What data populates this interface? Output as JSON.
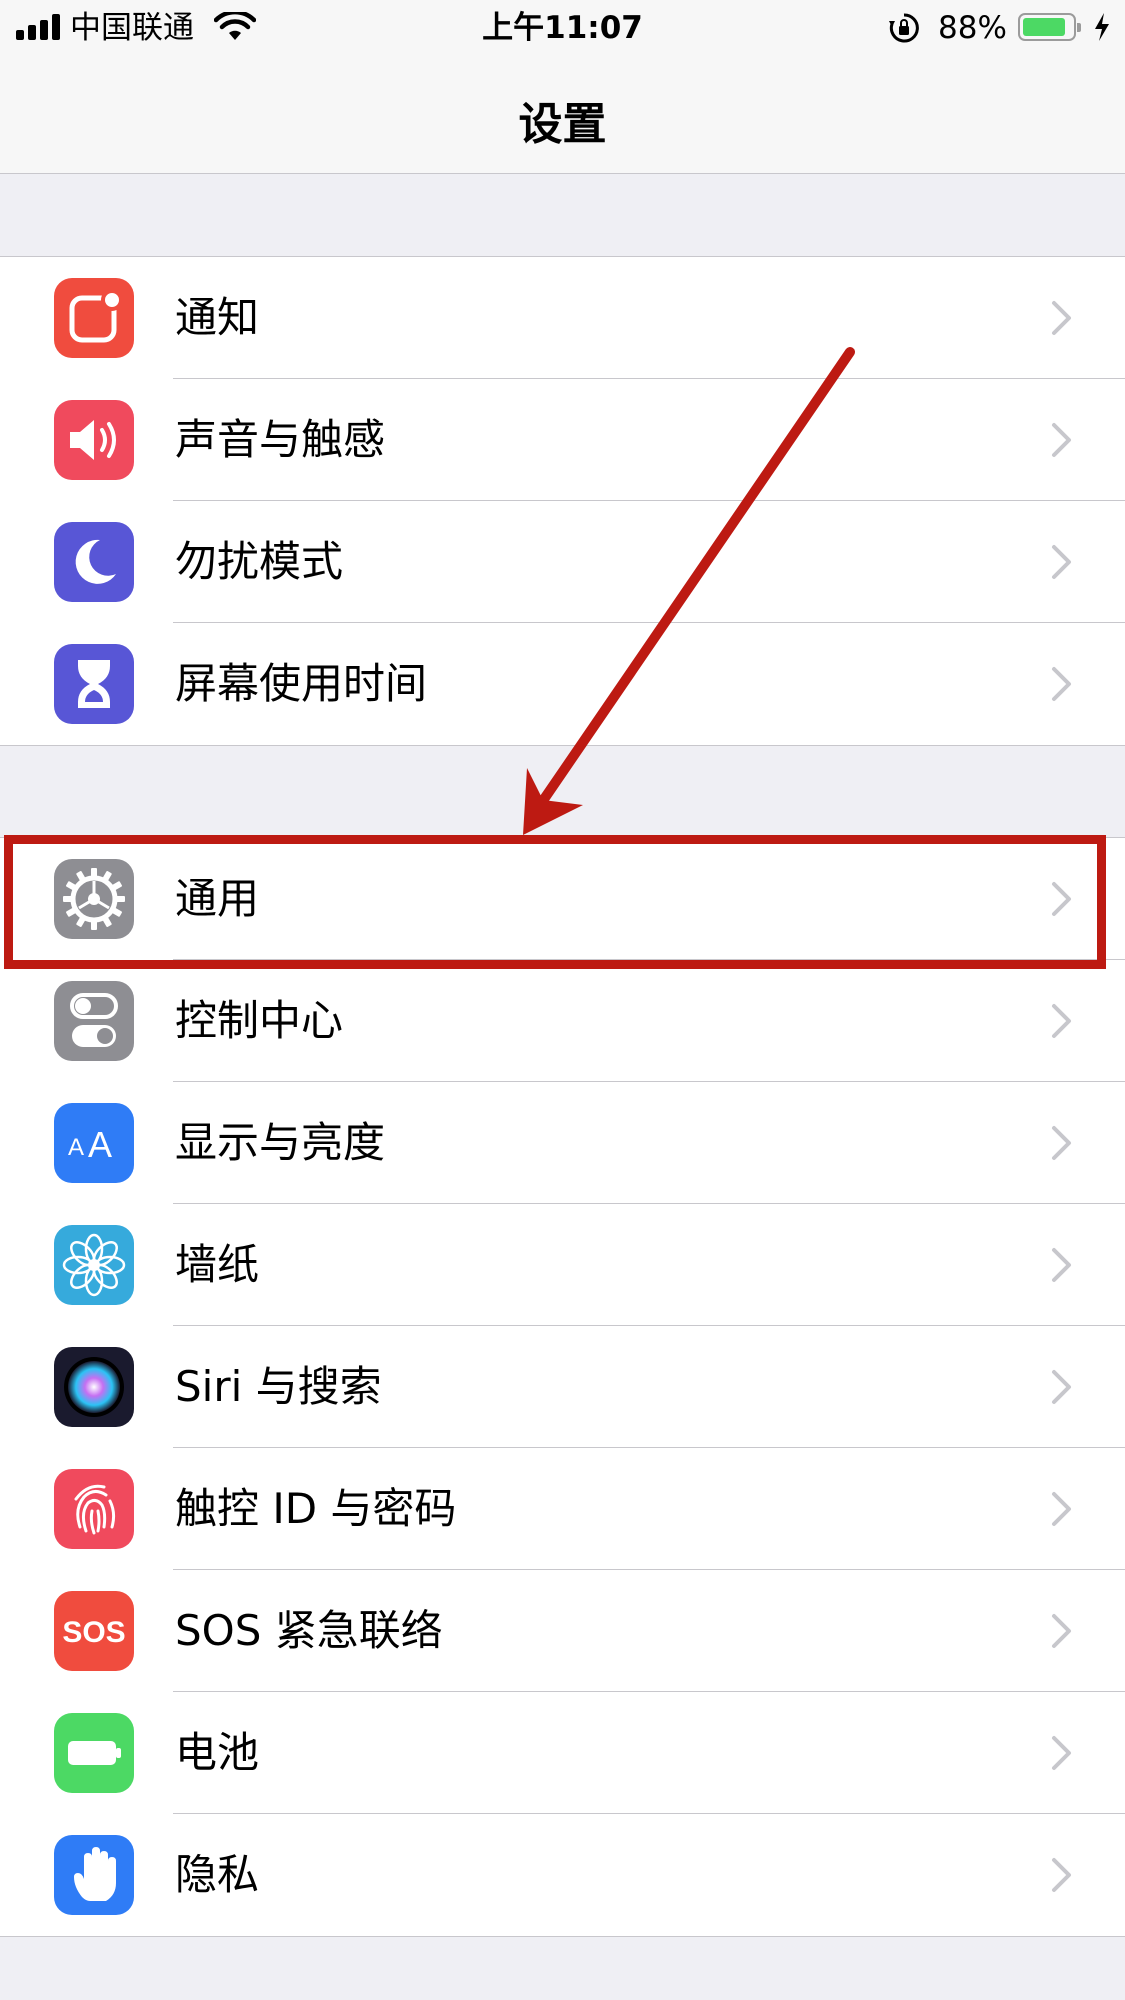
{
  "status_bar": {
    "carrier": "中国联通",
    "time": "上午11:07",
    "battery_percent_text": "88%",
    "battery_level": 0.88,
    "charging": true
  },
  "nav": {
    "title": "设置"
  },
  "groups": [
    {
      "items": [
        {
          "label": "通知",
          "icon": "notifications-icon",
          "color": "#f04c3e"
        },
        {
          "label": "声音与触感",
          "icon": "sound-icon",
          "color": "#f04a5d"
        },
        {
          "label": "勿扰模式",
          "icon": "moon-icon",
          "color": "#5856d6"
        },
        {
          "label": "屏幕使用时间",
          "icon": "hourglass-icon",
          "color": "#5856d6"
        }
      ]
    },
    {
      "items": [
        {
          "label": "通用",
          "icon": "gear-icon",
          "color": "#8e8e93",
          "highlighted": true
        },
        {
          "label": "控制中心",
          "icon": "toggles-icon",
          "color": "#8e8e93"
        },
        {
          "label": "显示与亮度",
          "icon": "text-size-icon",
          "color": "#2f7cf6"
        },
        {
          "label": "墙纸",
          "icon": "flower-icon",
          "color": "#36aadc"
        },
        {
          "label": "Siri 与搜索",
          "icon": "siri-icon",
          "color": "#1a1a2e"
        },
        {
          "label": "触控 ID 与密码",
          "icon": "fingerprint-icon",
          "color": "#f04a5d"
        },
        {
          "label": "SOS 紧急联络",
          "icon": "sos-icon",
          "color": "#f04c3e",
          "icon_text": "SOS"
        },
        {
          "label": "电池",
          "icon": "battery-icon",
          "color": "#4cd964"
        },
        {
          "label": "隐私",
          "icon": "hand-icon",
          "color": "#2f7cf6"
        }
      ]
    }
  ],
  "colors": {
    "annotation": "#bd1a12",
    "background": "#efeff4",
    "separator": "#c8c7cc"
  }
}
